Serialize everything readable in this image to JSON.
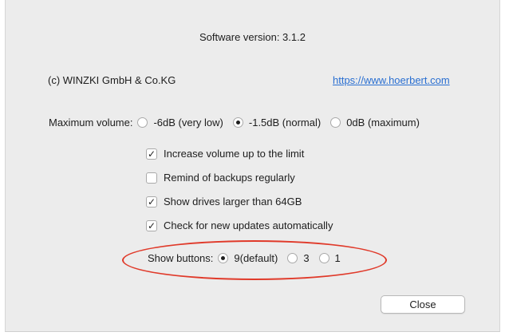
{
  "header": {
    "version_text": "Software version:  3.1.2"
  },
  "info": {
    "copyright": "(c) WINZKI GmbH & Co.KG",
    "website_link": "https://www.hoerbert.com"
  },
  "max_volume": {
    "label": "Maximum volume:",
    "options": [
      {
        "label": "-6dB (very low)",
        "selected": false
      },
      {
        "label": "-1.5dB (normal)",
        "selected": true
      },
      {
        "label": "0dB (maximum)",
        "selected": false
      }
    ]
  },
  "checkboxes": [
    {
      "label": "Increase volume up to the limit",
      "checked": true
    },
    {
      "label": "Remind of backups regularly",
      "checked": false
    },
    {
      "label": "Show drives larger than 64GB",
      "checked": true
    },
    {
      "label": "Check for new updates automatically",
      "checked": true
    }
  ],
  "show_buttons": {
    "label": "Show buttons:",
    "options": [
      {
        "label": "9(default)",
        "selected": true
      },
      {
        "label": "3",
        "selected": false
      },
      {
        "label": "1",
        "selected": false
      }
    ]
  },
  "footer": {
    "close_label": "Close"
  },
  "annotation": {
    "highlight_color": "#e03a2a"
  },
  "symbols": {
    "checkmark": "✓"
  }
}
